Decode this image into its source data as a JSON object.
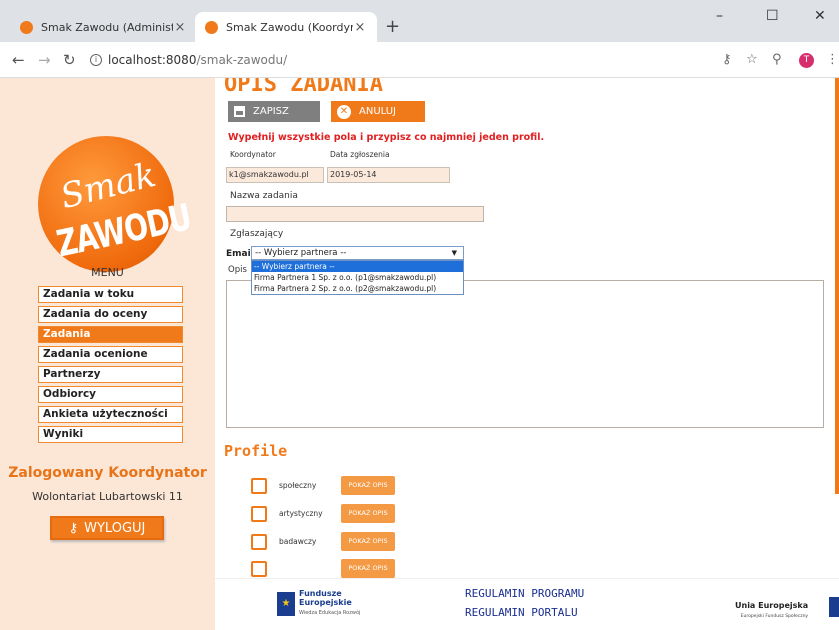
{
  "browser": {
    "tabs": [
      {
        "title": "Smak Zawodu (Administrator)",
        "close": "×"
      },
      {
        "title": "Smak Zawodu (Koordynator)",
        "close": "×"
      }
    ],
    "new_tab": "+",
    "window_controls": {
      "minimize": "–",
      "maximize": "☐",
      "close": "✕"
    },
    "url_host": "localhost:8080",
    "url_path": "/smak-zawodu/",
    "profile_initial": "T"
  },
  "sidebar": {
    "logo_line1": "Smak",
    "logo_line2": "ZAWODU",
    "menu_title": "MENU",
    "items": [
      "Zadania w toku",
      "Zadania do oceny",
      "Zadania",
      "Zadania ocenione",
      "Partnerzy",
      "Odbiorcy",
      "Ankieta użyteczności",
      "Wyniki"
    ],
    "active_index": 2,
    "logged_in_as": "Zalogowany Koordynator",
    "organization": "Wolontariat Lubartowski 11",
    "logout_label": "WYLOGUJ"
  },
  "form": {
    "title": "OPIS ZADANIA",
    "save_label": "ZAPISZ",
    "cancel_label": "ANULUJ",
    "warning": "Wypełnij wszystkie pola i przypisz co najmniej jeden profil.",
    "coordinator_label": "Koordynator",
    "coordinator_value": "k1@smakzawodu.pl",
    "date_label": "Data zgłoszenia",
    "date_value": "2019-05-14",
    "task_name_label": "Nazwa zadania",
    "task_name_value": "",
    "reporter_label": "Zgłaszający",
    "email_label": "Email:",
    "email_selected": "-- Wybierz partnera --",
    "email_options": [
      "-- Wybierz partnera --",
      "Firma Partnera 1 Sp. z o.o. (p1@smakzawodu.pl)",
      "Firma Partnera 2 Sp. z o.o. (p2@smakzawodu.pl)"
    ],
    "description_label": "Opis",
    "profiles_title": "Profile",
    "profiles": [
      {
        "name": "społeczny",
        "button": "POKAŻ OPIS"
      },
      {
        "name": "artystyczny",
        "button": "POKAŻ OPIS"
      },
      {
        "name": "badawczy",
        "button": "POKAŻ OPIS"
      },
      {
        "name": "",
        "button": "POKAŻ OPIS"
      }
    ]
  },
  "footer": {
    "fe_line1": "Fundusze",
    "fe_line2": "Europejskie",
    "fe_line3": "Wiedza Edukacja Rozwój",
    "regulamin_programu": "REGULAMIN PROGRAMU",
    "regulamin_portalu": "REGULAMIN PORTALU",
    "ue_line1": "Unia Europejska",
    "ue_line2": "Europejski Fundusz Społeczny"
  },
  "colors": {
    "accent": "#f07a1a",
    "sidebar_bg": "#fce7d6",
    "warning": "#e02020",
    "footer_link": "#1a2f8f"
  }
}
